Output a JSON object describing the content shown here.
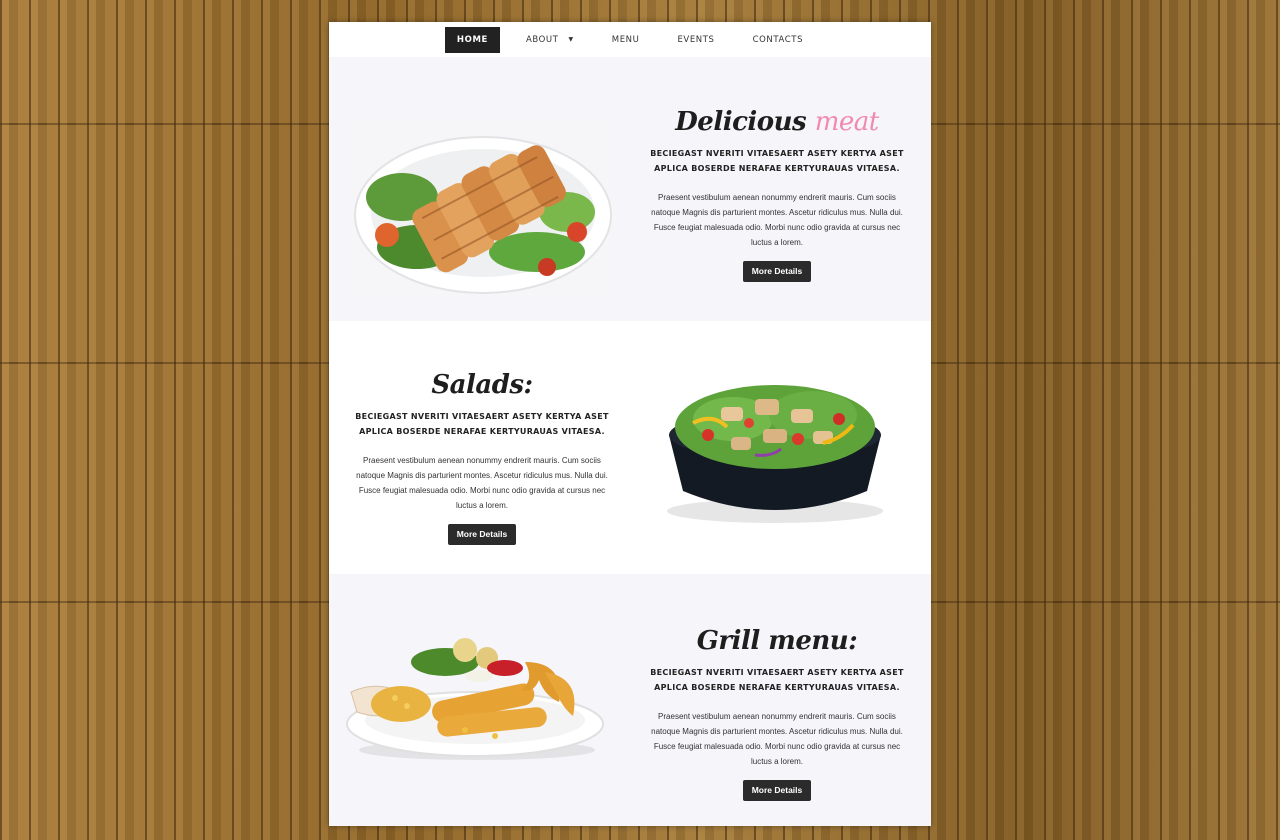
{
  "nav": {
    "items": [
      {
        "label": "HOME",
        "active": true
      },
      {
        "label": "ABOUT",
        "dropdown": true
      },
      {
        "label": "MENU"
      },
      {
        "label": "EVENTS"
      },
      {
        "label": "CONTACTS"
      }
    ],
    "dropdown_icon": "caret-down-icon"
  },
  "sections": [
    {
      "title": "Delicious",
      "title_accent": "meat",
      "subhead": "BECIEGAST NVERITI VITAESAERT ASETY KERTYA ASET APLICA BOSERDE NERAFAE KERTYURAUAS VITAESA.",
      "body": "Praesent vestibulum aenean nonummy endrerit mauris. Cum sociis natoque Magnis dis parturient montes. Ascetur ridiculus mus. Nulla dui. Fusce feugiat malesuada odio. Morbi nunc odio gravida at cursus nec luctus a lorem.",
      "button": "More Details",
      "image": "grilled-chicken-plate"
    },
    {
      "title": "Salads:",
      "title_accent": "",
      "subhead": "BECIEGAST NVERITI VITAESAERT ASETY KERTYA ASET APLICA BOSERDE NERAFAE KERTYURAUAS VITAESA.",
      "body": "Praesent vestibulum aenean nonummy endrerit mauris. Cum sociis natoque Magnis dis parturient montes. Ascetur ridiculus mus. Nulla dui. Fusce feugiat malesuada odio. Morbi nunc odio gravida at cursus nec luctus a lorem.",
      "button": "More Details",
      "image": "salad-bowl"
    },
    {
      "title": "Grill menu:",
      "title_accent": "",
      "subhead": "BECIEGAST NVERITI VITAESAERT ASETY KERTYA ASET APLICA BOSERDE NERAFAE KERTYURAUAS VITAESA.",
      "body": "Praesent vestibulum aenean nonummy endrerit mauris. Cum sociis natoque Magnis dis parturient montes. Ascetur ridiculus mus. Nulla dui. Fusce feugiat malesuada odio. Morbi nunc odio gravida at cursus nec luctus a lorem.",
      "button": "More Details",
      "image": "fried-shrimp-plate"
    }
  ],
  "colors": {
    "accent": "#f28ab0",
    "nav_active_bg": "#222222",
    "button_bg": "#2b2b2b",
    "section_alt_bg": "#f5f5fa",
    "wood_bg": "#8a6228"
  }
}
